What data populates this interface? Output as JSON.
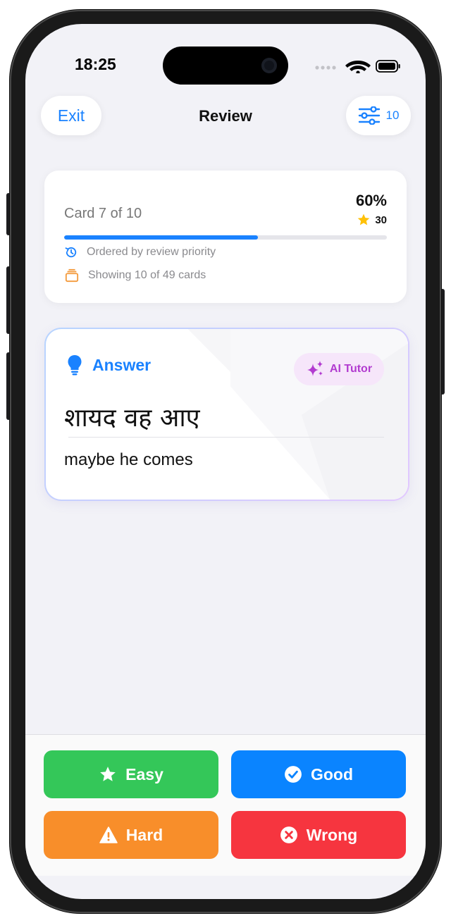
{
  "status_bar": {
    "time": "18:25"
  },
  "nav": {
    "exit_label": "Exit",
    "title": "Review",
    "filter_count": "10"
  },
  "progress": {
    "card_label": "Card 7 of 10",
    "percent_label": "60%",
    "percent_value": 0.6,
    "stars": "30",
    "order_text": "Ordered by review priority",
    "showing_text": "Showing 10 of 49 cards"
  },
  "answer_card": {
    "label": "Answer",
    "ai_tutor_label": "AI Tutor",
    "hindi_text": "शायद वह आए",
    "english_text": "maybe he comes"
  },
  "grades": {
    "easy": "Easy",
    "good": "Good",
    "hard": "Hard",
    "wrong": "Wrong"
  },
  "colors": {
    "accent": "#1a82ff",
    "easy": "#34c759",
    "good": "#0a84ff",
    "hard": "#f88e2a",
    "wrong": "#f6353f",
    "ai": "#b23bd0",
    "star": "#ffc107"
  }
}
